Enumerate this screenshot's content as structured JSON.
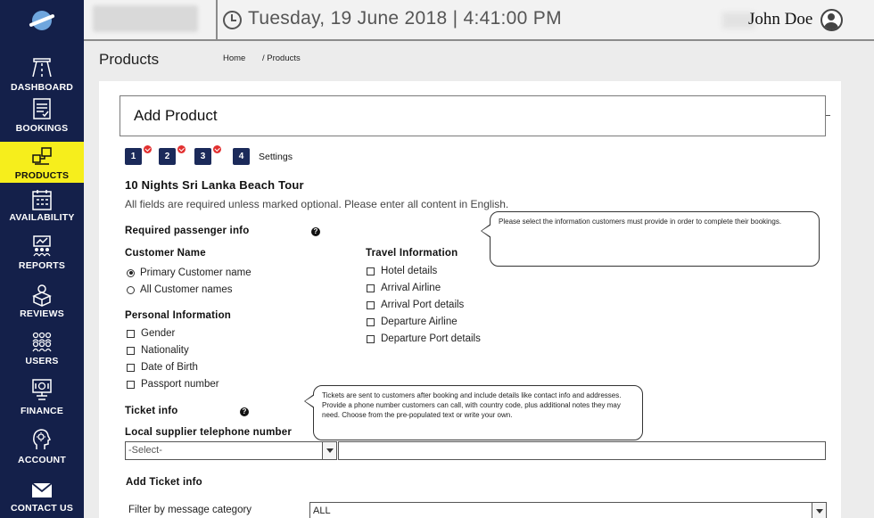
{
  "sidebar": {
    "items": [
      {
        "label": "DASHBOARD",
        "icon": "road-icon"
      },
      {
        "label": "BOOKINGS",
        "icon": "bookings-icon"
      },
      {
        "label": "PRODUCTS",
        "icon": "products-icon",
        "active": true
      },
      {
        "label": "AVAILABILITY",
        "icon": "calendar-icon"
      },
      {
        "label": "REPORTS",
        "icon": "reports-icon"
      },
      {
        "label": "REVIEWS",
        "icon": "reviews-icon"
      },
      {
        "label": "USERS",
        "icon": "users-icon"
      },
      {
        "label": "FINANCE",
        "icon": "finance-icon"
      },
      {
        "label": "ACCOUNT",
        "icon": "account-icon"
      },
      {
        "label": "CONTACT US",
        "icon": "envelope-icon"
      }
    ]
  },
  "header": {
    "datetime": "Tuesday, 19 June 2018 | 4:41:00 PM",
    "user_name": "John Doe"
  },
  "page": {
    "title": "Products",
    "breadcrumb_home": "Home",
    "breadcrumb_current": "/ Products"
  },
  "form": {
    "title": "Add Product",
    "steps": [
      "1",
      "2",
      "3",
      "4"
    ],
    "current_step_label": "Settings",
    "tour_name": "10 Nights Sri Lanka Beach Tour",
    "instructions": "All fields are required unless marked optional. Please enter all content in English.",
    "required_passenger_info": "Required passenger info",
    "passenger_tooltip": "Please select the information customers must provide in order to complete their bookings.",
    "customer_name": {
      "heading": "Customer Name",
      "options": [
        "Primary Customer name",
        "All Customer names"
      ]
    },
    "personal_information": {
      "heading": "Personal Information",
      "options": [
        "Gender",
        "Nationality",
        "Date of Birth",
        "Passport number"
      ]
    },
    "travel_information": {
      "heading": "Travel Information",
      "options": [
        "Hotel details",
        "Arrival Airline",
        "Arrival Port details",
        "Departure Airline",
        "Departure Port details"
      ]
    },
    "ticket_info": "Ticket info",
    "ticket_tooltip": "Tickets are sent to customers after booking and include details like contact info and addresses. Provide a phone number customers can call, with country code, plus additional notes they may need. Choose from the pre-populated text or write your own.",
    "supplier_phone_label": "Local supplier telephone number",
    "country_code_select": "-Select-",
    "add_ticket_info": "Add Ticket info",
    "filter_label": "Filter by message category",
    "filter_value": "ALL"
  },
  "colors": {
    "sidebar_bg": "#14204a",
    "sidebar_active": "#f6ee1c",
    "step_bg": "#1b2a5a",
    "step_check": "#e23030"
  }
}
